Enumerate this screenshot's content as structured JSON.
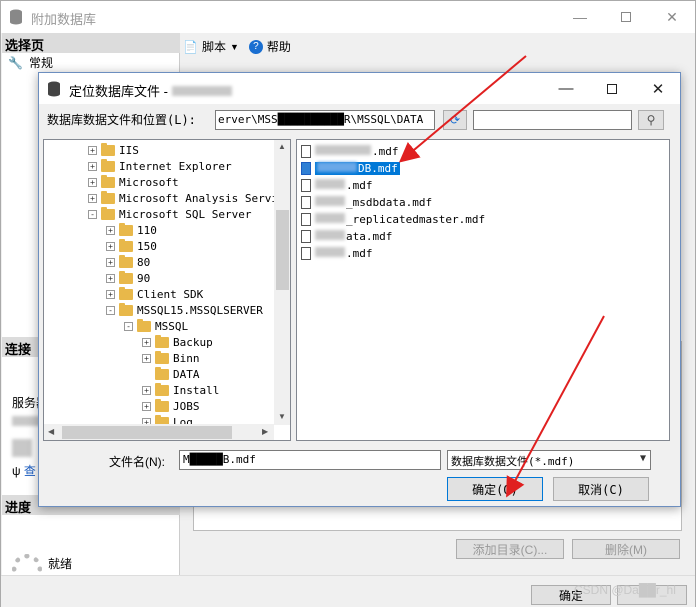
{
  "outer": {
    "title": "附加数据库",
    "select_page_header": "选择页",
    "page_item": "常规",
    "toolbar": {
      "script_label": "脚本",
      "help_label": "帮助"
    },
    "connection_header": "连接",
    "server_label": "服务器",
    "view_link": "查",
    "progress_header": "进度",
    "status_ready": "就绪",
    "add_catalog_button": "添加目录(C)...",
    "remove_button": "删除(M)",
    "ok_button": "确定"
  },
  "dialog": {
    "title": "定位数据库文件 -",
    "location_label": "数据库数据文件和位置(L):",
    "location_path": "erver\\MSS██████████R\\MSSQL\\DATA",
    "tree": [
      {
        "label": "IIS",
        "depth": 0,
        "toggle": "+"
      },
      {
        "label": "Internet Explorer",
        "depth": 0,
        "toggle": "+"
      },
      {
        "label": "Microsoft",
        "depth": 0,
        "toggle": "+"
      },
      {
        "label": "Microsoft Analysis Servic",
        "depth": 0,
        "toggle": "+"
      },
      {
        "label": "Microsoft SQL Server",
        "depth": 0,
        "toggle": "-"
      },
      {
        "label": "110",
        "depth": 1,
        "toggle": "+"
      },
      {
        "label": "150",
        "depth": 1,
        "toggle": "+"
      },
      {
        "label": "80",
        "depth": 1,
        "toggle": "+"
      },
      {
        "label": "90",
        "depth": 1,
        "toggle": "+"
      },
      {
        "label": "Client SDK",
        "depth": 1,
        "toggle": "+"
      },
      {
        "label": "MSSQL15.MSSQLSERVER",
        "depth": 1,
        "toggle": "-"
      },
      {
        "label": "MSSQL",
        "depth": 2,
        "toggle": "-"
      },
      {
        "label": "Backup",
        "depth": 3,
        "toggle": "+"
      },
      {
        "label": "Binn",
        "depth": 3,
        "toggle": "+"
      },
      {
        "label": "DATA",
        "depth": 3,
        "toggle": ""
      },
      {
        "label": "Install",
        "depth": 3,
        "toggle": "+"
      },
      {
        "label": "JOBS",
        "depth": 3,
        "toggle": "+"
      },
      {
        "label": "Log",
        "depth": 3,
        "toggle": "+"
      }
    ],
    "files": [
      {
        "name": ".mdf",
        "blur": 56,
        "selected": false
      },
      {
        "name": "DB.mdf",
        "blur": 40,
        "selected": true
      },
      {
        "name": ".mdf",
        "blur": 30,
        "selected": false
      },
      {
        "name": "_msdbdata.mdf",
        "blur": 30,
        "selected": false
      },
      {
        "name": "_replicatedmaster.mdf",
        "blur": 30,
        "selected": false
      },
      {
        "name": "ata.mdf",
        "blur": 30,
        "selected": false
      },
      {
        "name": ".mdf",
        "blur": 30,
        "selected": false
      }
    ],
    "filename_label": "文件名(N):",
    "filename_value": "M█████B.mdf",
    "filetype_value": "数据库数据文件(*.mdf)",
    "ok_button": "确定(O)",
    "cancel_button": "取消(C)"
  },
  "watermark": "CSDN @Da██r_hl",
  "colors": {
    "arrow": "#e02020",
    "selection": "#0078d7",
    "folder": "#e8b84a"
  }
}
